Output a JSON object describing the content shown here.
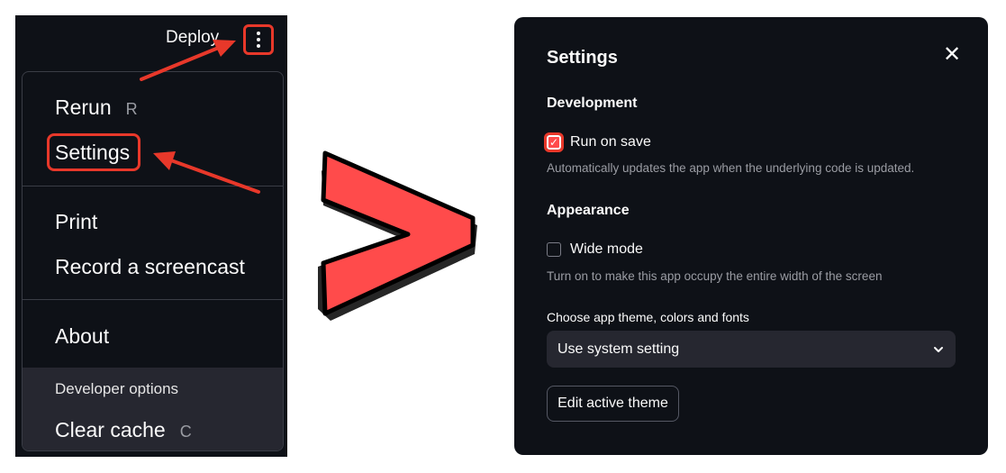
{
  "left": {
    "deploy_label": "Deploy",
    "menu": {
      "rerun_label": "Rerun",
      "rerun_shortcut": "R",
      "settings_label": "Settings",
      "print_label": "Print",
      "record_label": "Record a screencast",
      "about_label": "About",
      "dev_options_title": "Developer options",
      "clear_cache_label": "Clear cache",
      "clear_cache_shortcut": "C"
    }
  },
  "settings": {
    "title": "Settings",
    "close_icon": "✕",
    "development_title": "Development",
    "run_on_save_label": "Run on save",
    "run_on_save_checked": true,
    "run_on_save_help": "Automatically updates the app when the underlying code is updated.",
    "appearance_title": "Appearance",
    "wide_mode_label": "Wide mode",
    "wide_mode_checked": false,
    "wide_mode_help": "Turn on to make this app occupy the entire width of the screen",
    "theme_label": "Choose app theme, colors and fonts",
    "theme_value": "Use system setting",
    "edit_theme_label": "Edit active theme"
  },
  "colors": {
    "background": "#0e1117",
    "annotation_red": "#e8382a",
    "accent": "#ff4b4b",
    "secondary_bg": "#262730"
  }
}
